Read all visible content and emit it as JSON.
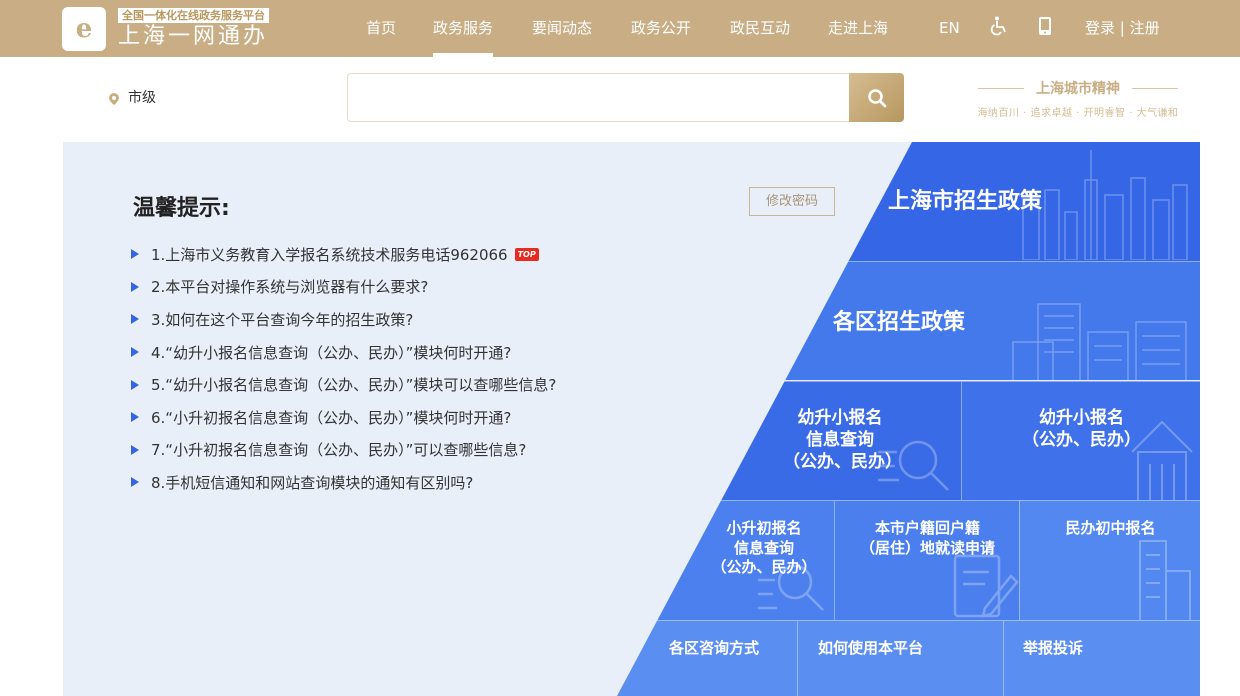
{
  "header": {
    "logo_sub": "全国一体化在线政务服务平台",
    "logo_main": "上海一网通办",
    "logo_letter": "e",
    "nav": [
      "首页",
      "政务服务",
      "要闻动态",
      "政务公开",
      "政民互动",
      "走进上海"
    ],
    "active_nav": "政务服务",
    "lang": "EN",
    "accessibility_icon": "wheelchair-icon",
    "mobile_icon": "mobile-phone-icon",
    "login": "登录 | 注册",
    "brand_color": "#c9ae85"
  },
  "location": {
    "icon": "map-pin-icon",
    "label": "市级"
  },
  "search": {
    "placeholder": "",
    "icon": "search-icon"
  },
  "slogan": {
    "title": "上海城市精神",
    "subtitle": "海纳百川 · 追求卓越 · 开明睿智 · 大气谦和"
  },
  "tips": {
    "title": "温馨提示:",
    "change_password": "修改密码",
    "top_badge": "TOP",
    "items": [
      "1.上海市义务教育入学报名系统技术服务电话962066",
      "2.本平台对操作系统与浏览器有什么要求?",
      "3.如何在这个平台查询今年的招生政策?",
      "4.“幼升小报名信息查询（公办、民办）”模块何时开通?",
      "5.“幼升小报名信息查询（公办、民办）”模块可以查哪些信息?",
      "6.“小升初报名信息查询（公办、民办）”模块何时开通?",
      "7.“小升初报名信息查询（公办、民办）”可以查哪些信息?",
      "8.手机短信通知和网站查询模块的通知有区别吗?"
    ]
  },
  "tiles": {
    "city_policy": "上海市招生政策",
    "district_policy": "各区招生政策",
    "primary_query": [
      "幼升小报名",
      "信息查询",
      "（公办、民办）"
    ],
    "primary_signup": [
      "幼升小报名",
      "（公办、民办）"
    ],
    "junior_query": [
      "小升初报名",
      "信息查询",
      "（公办、民办）"
    ],
    "hukou": [
      "本市户籍回户籍",
      "（居住）地就读申请"
    ],
    "private_junior": "民办初中报名",
    "district_contact": "各区咨询方式",
    "howto": "如何使用本平台",
    "report": "举报投诉"
  },
  "colors": {
    "tile_dark": "#3566e6",
    "tile_mid": "#4479ec",
    "tile_light": "#5b8ff1",
    "panel_bg": "#e9eff9"
  }
}
